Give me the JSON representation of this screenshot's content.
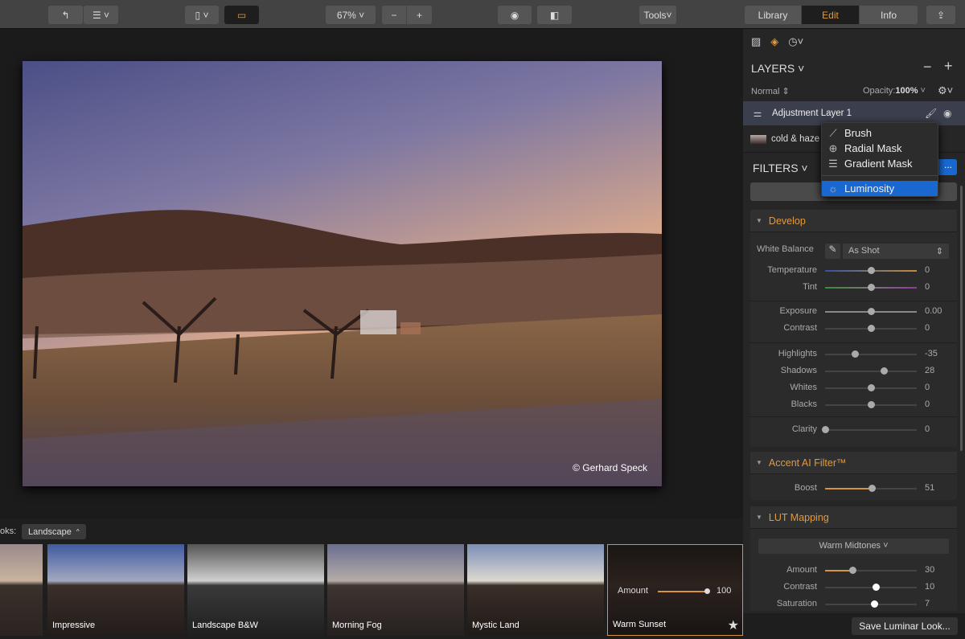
{
  "toolbar": {
    "zoom": "67%",
    "tools": "Tools",
    "tabs": [
      "Library",
      "Edit",
      "Info"
    ],
    "active_tab": "Edit",
    "accent": "#e29a3a"
  },
  "photo": {
    "credit": "© Gerhard Speck"
  },
  "film": {
    "looks_label": "oks:",
    "looks_category": "Landscape",
    "amount_label": "Amount",
    "amount_value": "100",
    "thumbs": [
      {
        "label": ""
      },
      {
        "label": "Impressive"
      },
      {
        "label": "Landscape B&W"
      },
      {
        "label": "Morning Fog"
      },
      {
        "label": "Mystic Land"
      },
      {
        "label": "Warm Sunset",
        "selected": true,
        "favorite": true
      }
    ]
  },
  "panel": {
    "layers_title": "LAYERS",
    "blend": "Normal",
    "opacity_label": "Opacity:",
    "opacity_value": "100%",
    "layers": [
      {
        "name": "Adjustment Layer 1"
      },
      {
        "name": "cold & haze"
      }
    ],
    "mask_menu": [
      {
        "label": "Brush",
        "icon": "brush-icon"
      },
      {
        "label": "Radial Mask",
        "icon": "radial-mask-icon"
      },
      {
        "label": "Gradient Mask",
        "icon": "gradient-mask-icon"
      },
      {
        "label": "Luminosity",
        "icon": "luminosity-icon",
        "highlighted": true
      }
    ],
    "filters_title": "FILTERS",
    "add_filters": "...",
    "custom_button": "Cus",
    "develop": {
      "title": "Develop",
      "wb_label": "White Balance",
      "wb_value": "As Shot",
      "sliders": [
        {
          "label": "Temperature",
          "value": "0",
          "pos": 0.5,
          "track": "temp"
        },
        {
          "label": "Tint",
          "value": "0",
          "pos": 0.5,
          "track": "tint"
        },
        {
          "label": "Exposure",
          "value": "0.00",
          "pos": 0.5
        },
        {
          "label": "Contrast",
          "value": "0",
          "pos": 0.5
        },
        {
          "label": "Highlights",
          "value": "-35",
          "pos": 0.325
        },
        {
          "label": "Shadows",
          "value": "28",
          "pos": 0.64
        },
        {
          "label": "Whites",
          "value": "0",
          "pos": 0.5
        },
        {
          "label": "Blacks",
          "value": "0",
          "pos": 0.5
        },
        {
          "label": "Clarity",
          "value": "0",
          "pos": 0
        }
      ]
    },
    "accent": {
      "title": "Accent AI Filter™",
      "sliders": [
        {
          "label": "Boost",
          "value": "51",
          "pos": 0.51,
          "fill": true
        }
      ]
    },
    "lut": {
      "title": "LUT Mapping",
      "preset": "Warm Midtones",
      "sliders": [
        {
          "label": "Amount",
          "value": "30",
          "pos": 0.3,
          "fill": true
        },
        {
          "label": "Contrast",
          "value": "10",
          "pos": 0.55
        },
        {
          "label": "Saturation",
          "value": "7",
          "pos": 0.535
        }
      ]
    },
    "save_look": "Save Luminar Look..."
  }
}
